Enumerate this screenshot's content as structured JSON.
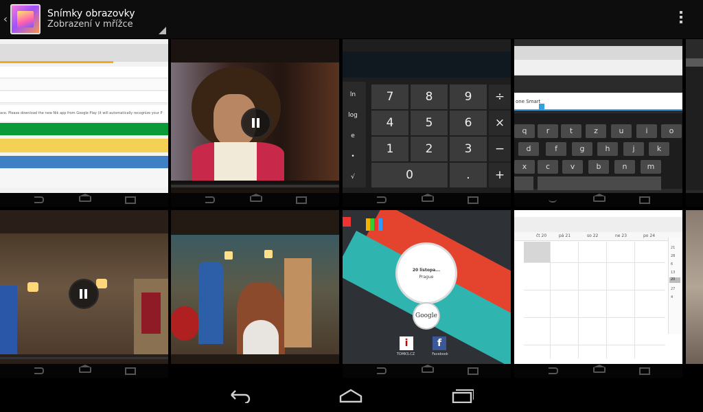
{
  "header": {
    "title": "Snímky obrazovky",
    "subtitle": "Zobrazení v mřížce"
  },
  "icons": {
    "up": "chevron-left-icon",
    "app": "gallery-icon",
    "overflow": "overflow-menu-icon"
  },
  "colors": {
    "actionbar": "#0d0d0d",
    "background": "#000000",
    "navbar_icon": "#555555"
  },
  "thumbnails": [
    {
      "label": "Screenshot of web page with banner",
      "text": "ace. Please download the new Nik app from Google Play (it will automatically recognize your P"
    },
    {
      "label": "Screenshot of video player paused"
    },
    {
      "label": "Screenshot of calculator",
      "keys": [
        "7",
        "8",
        "9",
        "÷",
        "4",
        "5",
        "6",
        "×",
        "1",
        "2",
        "3",
        "−",
        "0",
        ".",
        "+"
      ],
      "side": [
        "ln",
        "log",
        "e",
        "•",
        "√"
      ]
    },
    {
      "label": "Screenshot of keyboard",
      "field_text": "one Smart",
      "rows": [
        [
          "q",
          "r",
          "t",
          "z",
          "u",
          "i",
          "o"
        ],
        [
          "d",
          "f",
          "g",
          "h",
          "j",
          "k"
        ],
        [
          "x",
          "c",
          "v",
          "b",
          "n",
          "m"
        ]
      ]
    },
    {
      "label": "Screenshot partial",
      "time": ""
    },
    {
      "label": "Screenshot of video player paused in room"
    },
    {
      "label": "Screenshot of video in room with girl"
    },
    {
      "label": "Screenshot of home screen with clock widget",
      "date": "20 listopa...",
      "city": "Prague",
      "google": "Google",
      "apps": [
        "TOMKS.CZ",
        "Facebook"
      ]
    },
    {
      "label": "Screenshot of calendar",
      "days": [
        "čt 20",
        "pá 21",
        "so 22",
        "ne 23",
        "po 24"
      ],
      "mini": [
        "21",
        "28",
        "6",
        "13",
        "20",
        "27",
        "4"
      ]
    },
    {
      "label": "Screenshot partial photo"
    }
  ]
}
